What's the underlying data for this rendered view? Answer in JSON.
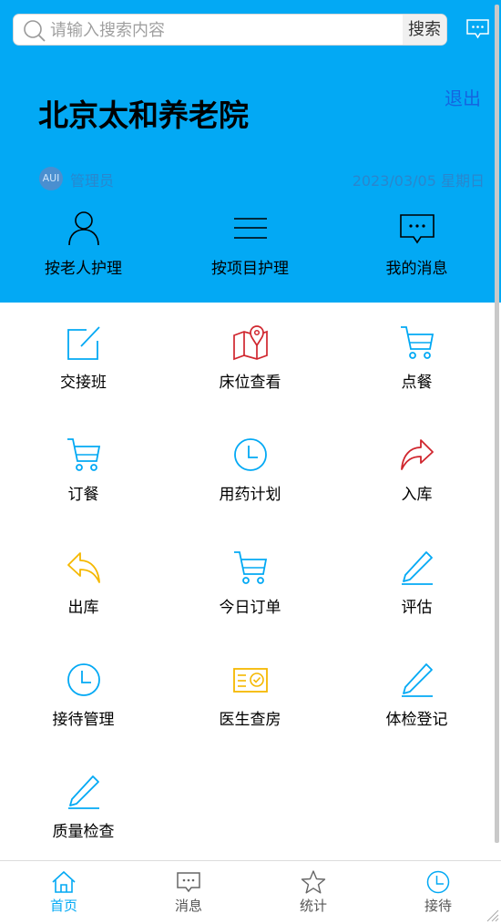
{
  "search": {
    "placeholder": "请输入搜索内容",
    "button_label": "搜索"
  },
  "header": {
    "title": "北京太和养老院",
    "logout_label": "退出",
    "avatar_text": "AUI",
    "user_name": "管理员",
    "date": "2023/03/05 星期日"
  },
  "quick_actions": [
    {
      "label": "按老人护理",
      "icon": "person-icon"
    },
    {
      "label": "按项目护理",
      "icon": "menu-lines-icon"
    },
    {
      "label": "我的消息",
      "icon": "message-icon"
    }
  ],
  "grid": [
    {
      "label": "交接班",
      "icon": "edit-icon"
    },
    {
      "label": "床位查看",
      "icon": "map-icon"
    },
    {
      "label": "点餐",
      "icon": "cart-icon"
    },
    {
      "label": "订餐",
      "icon": "cart-icon"
    },
    {
      "label": "用药计划",
      "icon": "clock-icon"
    },
    {
      "label": "入库",
      "icon": "forward-icon"
    },
    {
      "label": "出库",
      "icon": "reply-icon"
    },
    {
      "label": "今日订单",
      "icon": "cart-icon"
    },
    {
      "label": "评估",
      "icon": "pen-icon"
    },
    {
      "label": "接待管理",
      "icon": "clock-icon"
    },
    {
      "label": "医生查房",
      "icon": "certificate-icon"
    },
    {
      "label": "体检登记",
      "icon": "pen-icon"
    },
    {
      "label": "质量检查",
      "icon": "pen-icon"
    }
  ],
  "tabs": [
    {
      "label": "首页",
      "icon": "home-icon",
      "active": true
    },
    {
      "label": "消息",
      "icon": "message-icon"
    },
    {
      "label": "统计",
      "icon": "star-icon"
    },
    {
      "label": "接待",
      "icon": "clock-icon"
    }
  ],
  "colors": {
    "header_bg": "#03a9f4",
    "accent": "#03a9f4",
    "red": "#d0262e",
    "yellow": "#f5b800"
  }
}
